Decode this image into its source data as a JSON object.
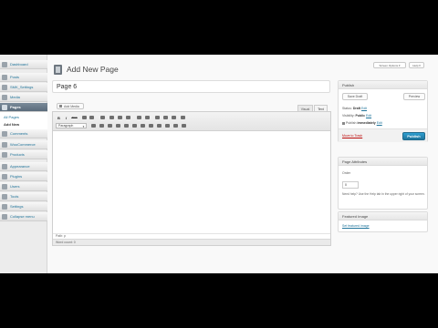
{
  "colors": {
    "link": "#21759b",
    "active_menu": "#6a7a8a",
    "publish_button": "#21759b",
    "trash": "#bc0b0b"
  },
  "sidebar": {
    "items": [
      {
        "label": "Dashboard",
        "icon": "dashboard-icon"
      },
      {
        "label": "Posts",
        "icon": "posts-icon"
      },
      {
        "label": "SMK_Settings",
        "icon": "settings-icon"
      },
      {
        "label": "Media",
        "icon": "media-icon"
      },
      {
        "label": "Pages",
        "icon": "pages-icon",
        "active": true
      },
      {
        "label": "Comments",
        "icon": "comments-icon"
      },
      {
        "label": "WooCommerce",
        "icon": "woocommerce-icon"
      },
      {
        "label": "Products",
        "icon": "products-icon"
      },
      {
        "label": "Appearance",
        "icon": "appearance-icon"
      },
      {
        "label": "Plugins",
        "icon": "plugins-icon"
      },
      {
        "label": "Users",
        "icon": "users-icon"
      },
      {
        "label": "Tools",
        "icon": "tools-icon"
      },
      {
        "label": "Settings",
        "icon": "settings-icon"
      },
      {
        "label": "Collapse menu",
        "icon": "collapse-icon"
      }
    ],
    "submenu": [
      {
        "label": "All Pages"
      },
      {
        "label": "Add New",
        "current": true
      }
    ]
  },
  "header": {
    "title": "Add New Page",
    "screen_options": "Screen Options ▾",
    "help": "Help ▾"
  },
  "title_field": {
    "value": "Page 6"
  },
  "editor": {
    "add_media": "Add Media",
    "tab_visual": "Visual",
    "tab_text": "Text",
    "row1": [
      "B",
      "I",
      "ABC"
    ],
    "format_select": "Paragraph",
    "path": "Path: p",
    "word_count": "Word count: 0"
  },
  "publish_box": {
    "title": "Publish",
    "save_draft": "Save Draft",
    "preview": "Preview",
    "status_label": "Status:",
    "status_value": "Draft",
    "visibility_label": "Visibility:",
    "visibility_value": "Public",
    "publish_label": "Publish",
    "publish_value": "immediately",
    "edit": "Edit",
    "trash": "Move to Trash",
    "publish_button": "Publish"
  },
  "attributes_box": {
    "title": "Page Attributes",
    "order_label": "Order",
    "order_value": "0",
    "help": "Need help? Use the Help tab in the upper right of your screen."
  },
  "featured_box": {
    "title": "Featured Image",
    "link": "Set featured image"
  }
}
